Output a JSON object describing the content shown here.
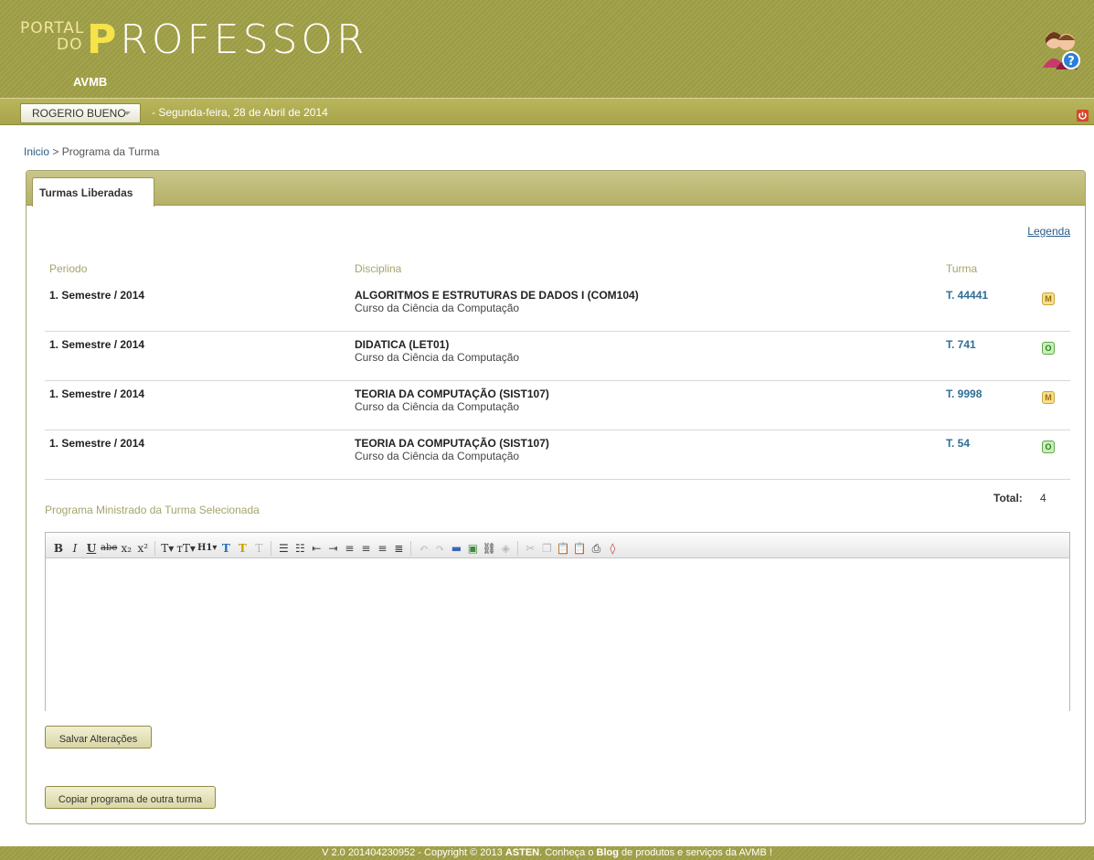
{
  "header": {
    "logo_small_top": "PORTAL",
    "logo_small_do": "DO",
    "logo_big_first": "P",
    "logo_big_rest": "ROFESSOR",
    "logo_sub": "AVMB"
  },
  "userbar": {
    "user_name": "ROGERIO BUENO",
    "date": "- Segunda-feira, 28 de Abril de 2014"
  },
  "breadcrumb": {
    "home": "Inicio",
    "separator": ">",
    "current": "Programa da Turma"
  },
  "tabs": [
    "Turmas Liberadas"
  ],
  "legend_link": "Legenda",
  "table": {
    "headers": {
      "periodo": "Periodo",
      "disciplina": "Disciplina",
      "turma": "Turma"
    },
    "rows": [
      {
        "periodo": "1. Semestre / 2014",
        "disciplina": "ALGORITMOS E ESTRUTURAS DE DADOS I (COM104)",
        "curso": "Curso da Ciência da Computação",
        "turma": "T. 44441",
        "badge": "M"
      },
      {
        "periodo": "1. Semestre / 2014",
        "disciplina": "DIDATICA (LET01)",
        "curso": "Curso da Ciência da Computação",
        "turma": "T. 741",
        "badge": "O"
      },
      {
        "periodo": "1. Semestre / 2014",
        "disciplina": "TEORIA DA COMPUTAÇÃO (SIST107)",
        "curso": "Curso da Ciência da Computação",
        "turma": "T. 9998",
        "badge": "M"
      },
      {
        "periodo": "1. Semestre / 2014",
        "disciplina": "TEORIA DA COMPUTAÇÃO (SIST107)",
        "curso": "Curso da Ciência da Computação",
        "turma": "T. 54",
        "badge": "O"
      }
    ],
    "total_label": "Total:",
    "total_value": "4"
  },
  "programa": {
    "title": "Programa Ministrado da Turma Selecionada",
    "save_button": "Salvar Alterações",
    "copy_button": "Copiar programa de outra turma"
  },
  "editor_toolbar": {
    "bold": "B",
    "italic": "I",
    "underline": "U",
    "strike": "abe",
    "subscript": "x₂",
    "superscript": "x²",
    "font_size": "T▾",
    "font_family": "тT▾",
    "heading": "H1▾"
  },
  "footer": {
    "version": "V 2.0 201404230952 - Copyright © 2013",
    "brand": "ASTEN",
    "text_mid": ". Conheça o",
    "blog": "Blog",
    "text_end": "de produtos e serviços da AVMB !"
  },
  "colors": {
    "header_olive": "#a5a44e",
    "link_blue": "#2a5c8a",
    "turma_blue": "#2f6e96",
    "header_label": "#a4a46c"
  }
}
